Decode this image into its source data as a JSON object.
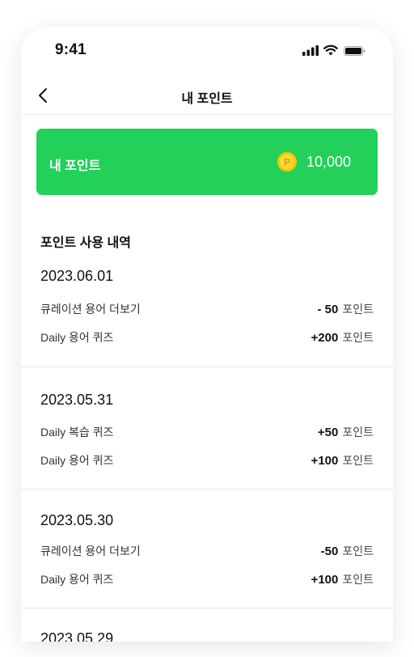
{
  "status_bar": {
    "time": "9:41"
  },
  "nav": {
    "title": "내 포인트"
  },
  "points_card": {
    "label": "내 포인트",
    "value": "10,000",
    "coin_glyph": "P"
  },
  "history": {
    "title": "포인트 사용 내역",
    "sections": [
      {
        "date": "2023.06.01",
        "rows": [
          {
            "desc": "큐레이션 용어 더보기",
            "amount": "- 50",
            "unit": "포인트"
          },
          {
            "desc": "Daily 용어 퀴즈",
            "amount": "+200",
            "unit": "포인트"
          }
        ]
      },
      {
        "date": "2023.05.31",
        "rows": [
          {
            "desc": "Daily 복습 퀴즈",
            "amount": "+50",
            "unit": "포인트"
          },
          {
            "desc": "Daily 용어 퀴즈",
            "amount": "+100",
            "unit": "포인트"
          }
        ]
      },
      {
        "date": "2023.05.30",
        "rows": [
          {
            "desc": "큐레이션 용어 더보기",
            "amount": "-50",
            "unit": "포인트"
          },
          {
            "desc": "Daily 용어 퀴즈",
            "amount": "+100",
            "unit": "포인트"
          }
        ]
      },
      {
        "date": "2023.05.29",
        "rows": []
      }
    ]
  },
  "colors": {
    "accent_green": "#22d05a",
    "coin_yellow": "#f7c600"
  }
}
